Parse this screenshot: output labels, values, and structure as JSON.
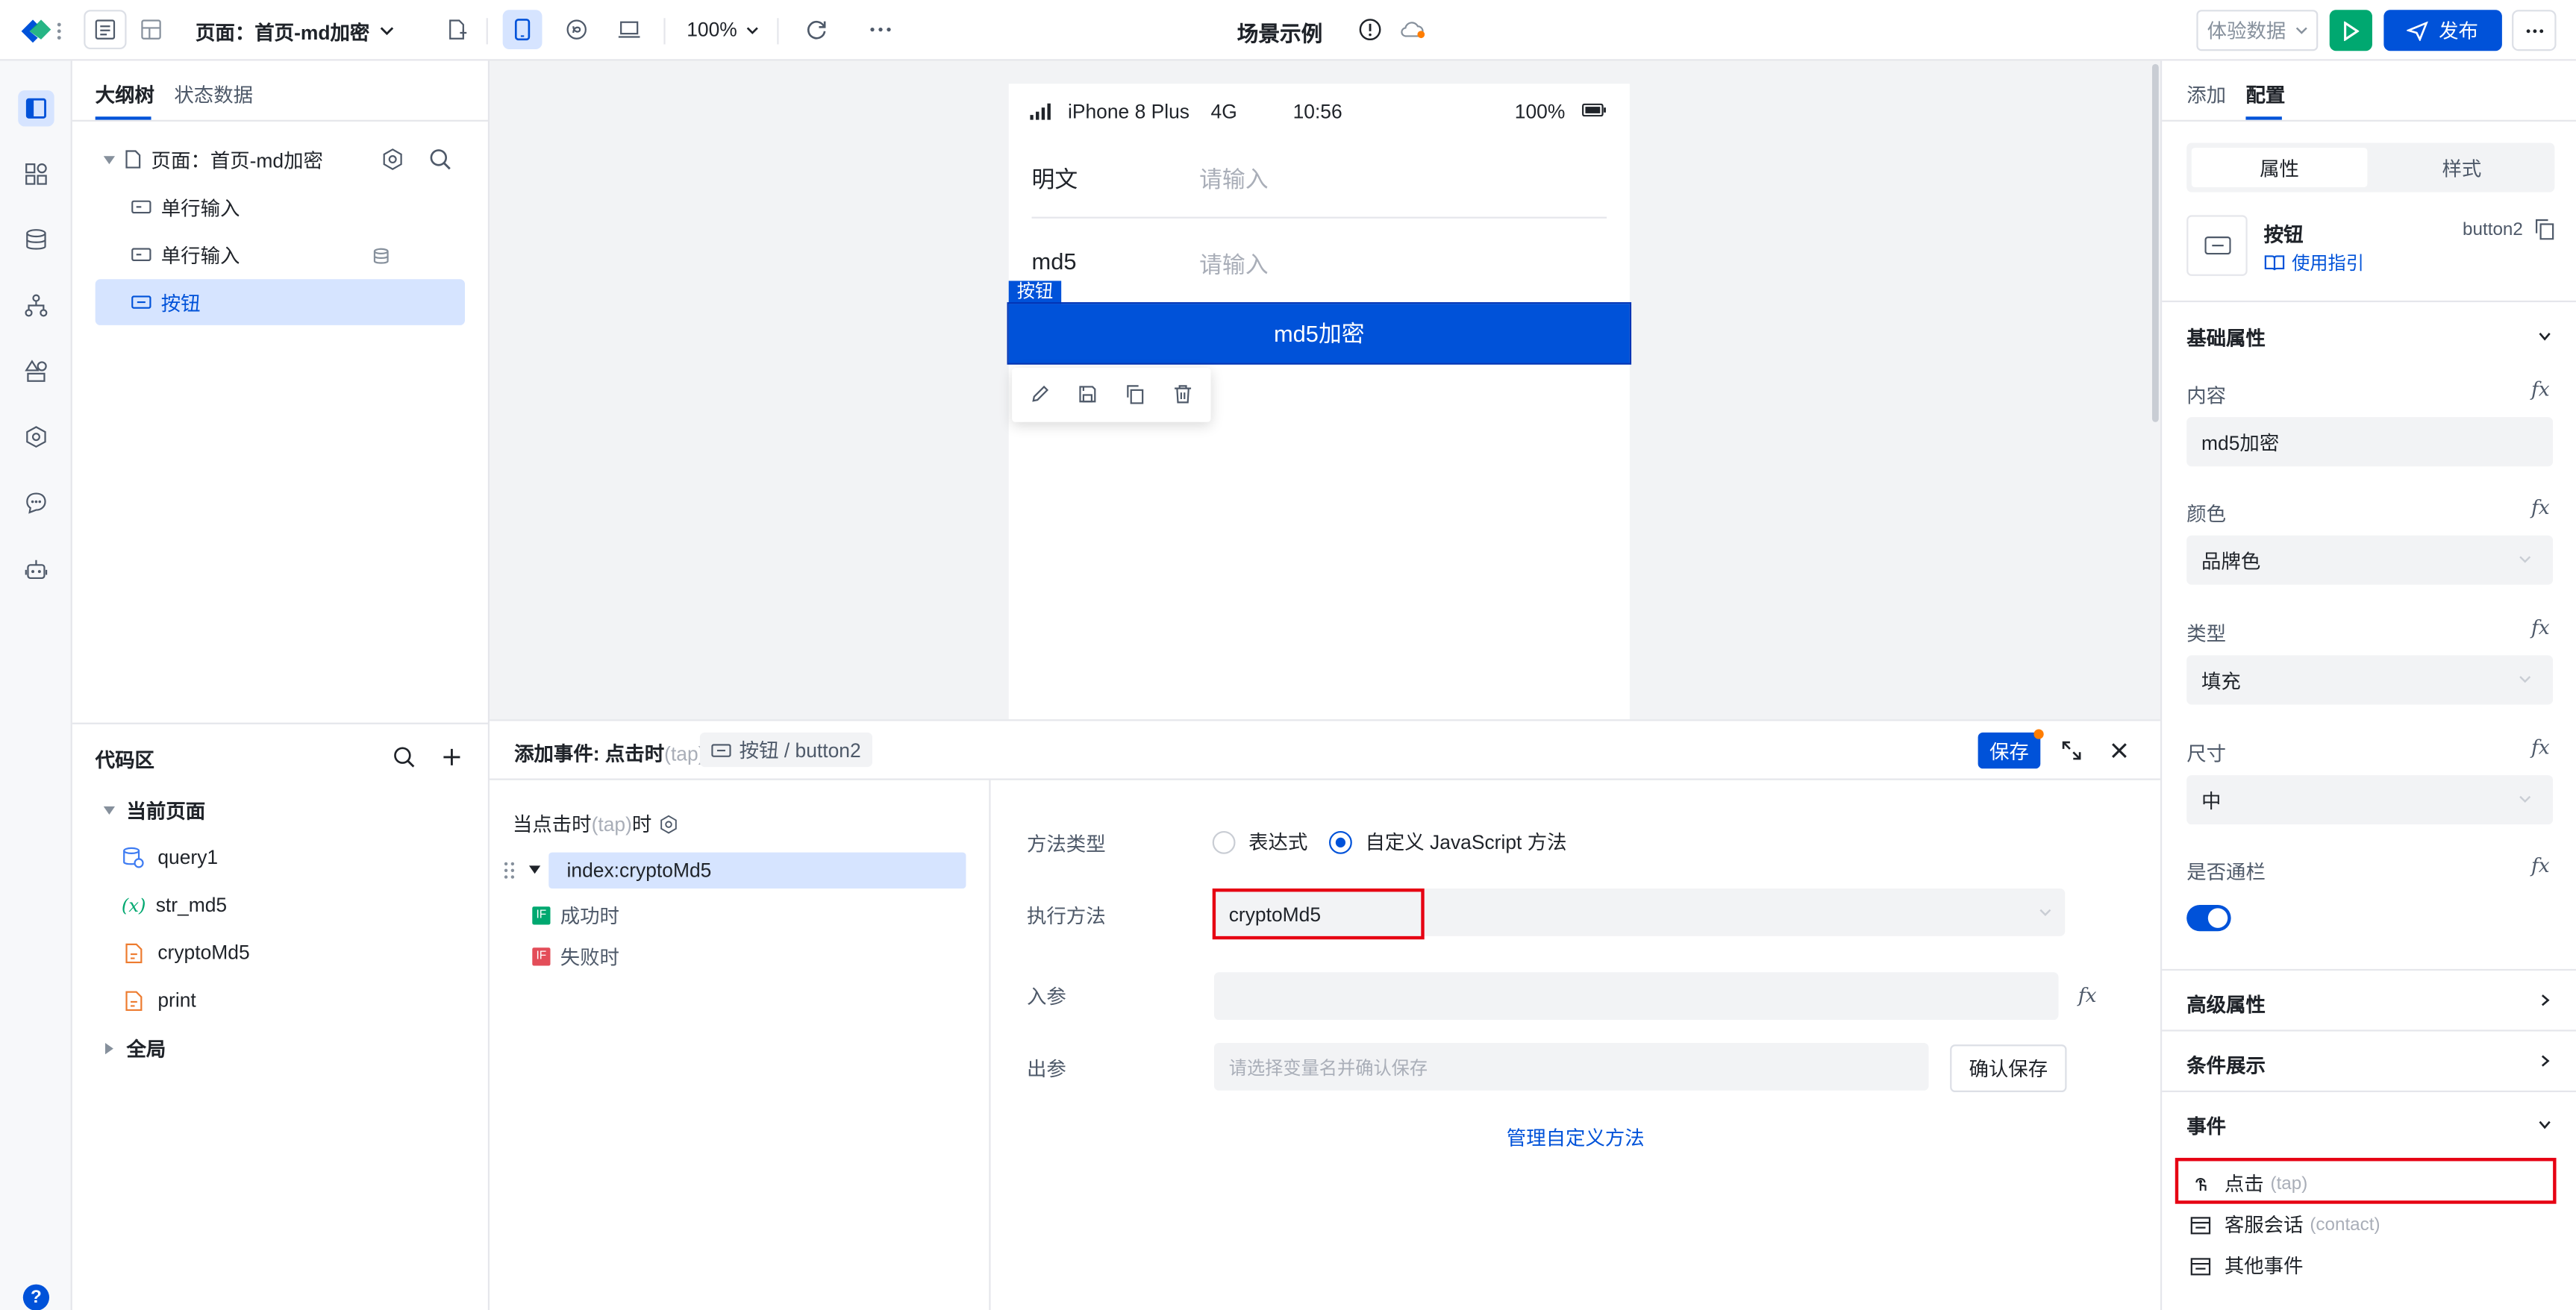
{
  "topbar": {
    "page_selector": "页面：首页-md加密",
    "zoom": "100%",
    "title": "场景示例",
    "data_mode": "体验数据",
    "publish_label": "发布"
  },
  "left_panel": {
    "tabs": [
      "大纲树",
      "状态数据"
    ],
    "tree": {
      "page": "页面：首页-md加密",
      "items": [
        "单行输入",
        "单行输入",
        "按钮"
      ]
    },
    "code_area": {
      "title": "代码区",
      "current_page": "当前页面",
      "items": [
        "query1",
        "str_md5",
        "cryptoMd5",
        "print"
      ],
      "global": "全局"
    }
  },
  "phone": {
    "status": {
      "carrier": "iPhone 8 Plus",
      "network": "4G",
      "time": "10:56",
      "battery": "100%"
    },
    "rows": [
      {
        "label": "明文",
        "placeholder": "请输入"
      },
      {
        "label": "md5",
        "placeholder": "请输入"
      }
    ],
    "selected_tag": "按钮",
    "button_label": "md5加密"
  },
  "event_panel": {
    "title": "添加事件: 点击时",
    "title_suffix": "(tap)",
    "component_path": "按钮 / button2",
    "save_label": "保存",
    "trigger_prefix": "当点击时",
    "trigger_suffix": "(tap)",
    "trigger_end": "时",
    "action": "index:cryptoMd5",
    "success": "成功时",
    "fail": "失败时",
    "if_tag": "IF",
    "method_type_label": "方法类型",
    "radio_expr": "表达式",
    "radio_custom": "自定义 JavaScript 方法",
    "exec_method_label": "执行方法",
    "exec_method_value": "cryptoMd5",
    "input_params_label": "入参",
    "output_params_label": "出参",
    "output_placeholder": "请选择变量名并确认保存",
    "confirm_save": "确认保存",
    "manage_methods": "管理自定义方法"
  },
  "right_panel": {
    "tabs": [
      "添加",
      "配置"
    ],
    "sub_tabs": [
      "属性",
      "样式"
    ],
    "component_name": "按钮",
    "component_id": "button2",
    "guide_link": "使用指引",
    "basic_props": "基础属性",
    "props": [
      {
        "label": "内容",
        "value": "md5加密"
      },
      {
        "label": "颜色",
        "value": "品牌色"
      },
      {
        "label": "类型",
        "value": "填充"
      },
      {
        "label": "尺寸",
        "value": "中"
      }
    ],
    "block_label": "是否通栏",
    "block_enabled": true,
    "advanced_props": "高级属性",
    "condition_display": "条件展示",
    "events_title": "事件",
    "events": [
      {
        "name": "点击",
        "code": "(tap)"
      },
      {
        "name": "客服会话",
        "code": "(contact)"
      },
      {
        "name": "其他事件",
        "code": ""
      }
    ]
  },
  "colors": {
    "brand": "#0052d9",
    "green": "#00a870",
    "red": "#e34d59",
    "highlight": "#e60012"
  }
}
